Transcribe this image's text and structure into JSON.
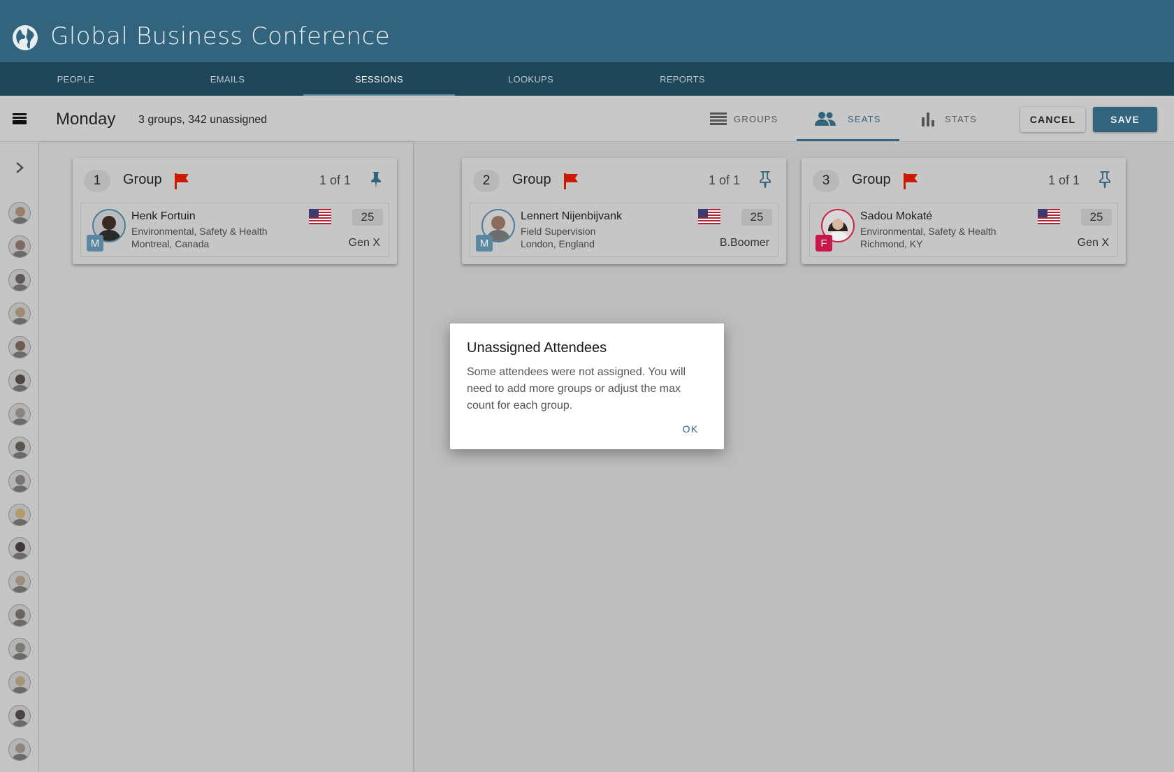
{
  "app": {
    "title": "Global Business Conference"
  },
  "nav": {
    "tabs": [
      {
        "label": "PEOPLE"
      },
      {
        "label": "EMAILS"
      },
      {
        "label": "SESSIONS"
      },
      {
        "label": "LOOKUPS"
      },
      {
        "label": "REPORTS"
      }
    ],
    "active": "SESSIONS"
  },
  "toolbar": {
    "day": "Monday",
    "summary": "3 groups, 342 unassigned",
    "views": [
      {
        "label": "GROUPS",
        "icon": "list-icon"
      },
      {
        "label": "SEATS",
        "icon": "people-icon"
      },
      {
        "label": "STATS",
        "icon": "bar-chart-icon"
      }
    ],
    "active_view": "SEATS",
    "cancel_label": "CANCEL",
    "save_label": "SAVE"
  },
  "colors": {
    "header": "#33647e",
    "nav": "#1e4558",
    "accent": "#33647e",
    "flag": "#cc1a00",
    "female": "#c9164b",
    "male": "#5c87a0"
  },
  "sidebar": {
    "unassigned_count_shown": 17
  },
  "groups": [
    {
      "number": "1",
      "label": "Group",
      "count": "1 of 1",
      "pinned": true,
      "person": {
        "name": "Henk Fortuin",
        "department": "Environmental, Safety & Health",
        "location": "Montreal, Canada",
        "gender": "M",
        "age": "25",
        "generation": "Gen X"
      }
    },
    {
      "number": "2",
      "label": "Group",
      "count": "1 of 1",
      "pinned": false,
      "person": {
        "name": "Lennert Nijenbijvank",
        "department": "Field Supervision",
        "location": "London, England",
        "gender": "M",
        "age": "25",
        "generation": "B.Boomer"
      }
    },
    {
      "number": "3",
      "label": "Group",
      "count": "1 of 1",
      "pinned": false,
      "person": {
        "name": "Sadou Mokaté",
        "department": "Environmental, Safety & Health",
        "location": "Richmond, KY",
        "gender": "F",
        "age": "25",
        "generation": "Gen X"
      }
    }
  ],
  "dialog": {
    "title": "Unassigned Attendees",
    "body": "Some attendees were not assigned. You will need to add more groups or adjust the max count for each group.",
    "ok_label": "OK"
  }
}
